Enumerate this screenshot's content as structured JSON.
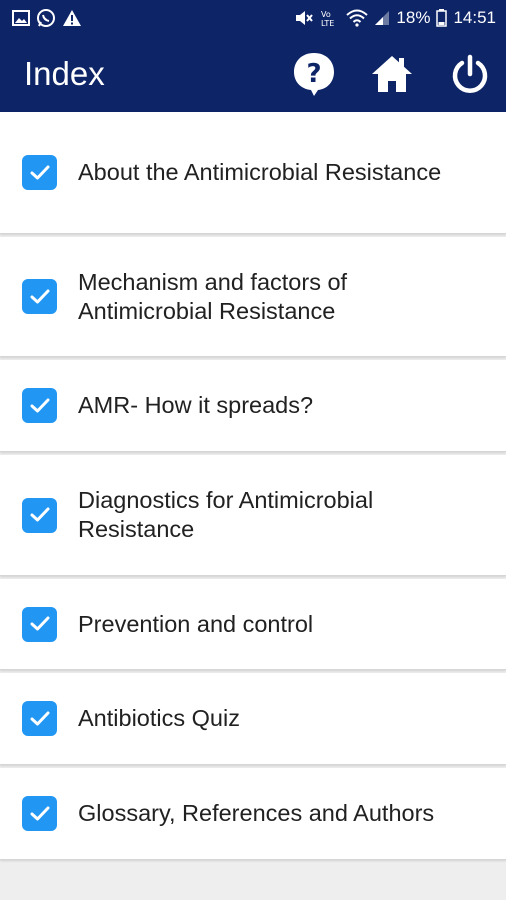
{
  "status_bar": {
    "battery": "18%",
    "time": "14:51",
    "icons_left": [
      "image-icon",
      "whatsapp-icon",
      "warning-icon"
    ],
    "icons_right": [
      "mute-icon",
      "volte-icon",
      "wifi-icon",
      "signal-icon",
      "battery-icon"
    ]
  },
  "app_bar": {
    "title": "Index",
    "actions": [
      "help-icon",
      "home-icon",
      "power-icon"
    ]
  },
  "items": [
    {
      "label": "About the Antimicrobial Resistance",
      "checked": true
    },
    {
      "label": "Mechanism and factors of Antimicrobial Resistance",
      "checked": true
    },
    {
      "label": "AMR- How it spreads?",
      "checked": true
    },
    {
      "label": "Diagnostics for Antimicrobial Resistance",
      "checked": true
    },
    {
      "label": "Prevention and control",
      "checked": true
    },
    {
      "label": "Antibiotics Quiz",
      "checked": true
    },
    {
      "label": "Glossary, References and Authors",
      "checked": true
    }
  ],
  "colors": {
    "header": "#0d2467",
    "checkbox": "#2196f3",
    "background": "#eeeeee",
    "card": "#ffffff",
    "text": "#212121"
  }
}
